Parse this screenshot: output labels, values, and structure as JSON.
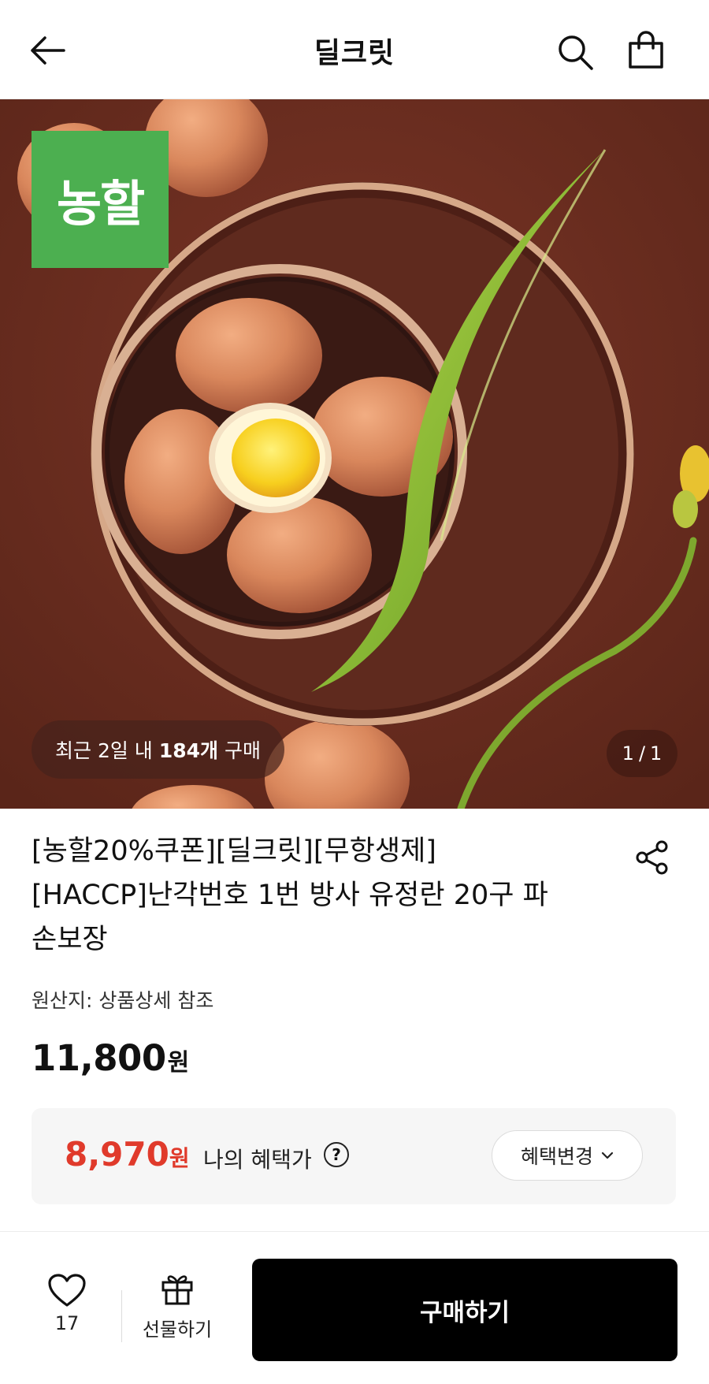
{
  "header": {
    "title": "딜크릿",
    "back_icon": "arrow-left-icon",
    "search_icon": "search-icon",
    "cart_icon": "shopping-bag-icon"
  },
  "hero": {
    "brand_logo_text": "농할",
    "brand_logo_color": "#4caf50",
    "recent_prefix": "최근 2일 내",
    "recent_count": "184개",
    "recent_suffix": "구매",
    "page_current": "1",
    "page_separator": "/",
    "page_total": "1"
  },
  "product": {
    "title_line1": "[농할20%쿠폰][딜크릿][무항생제]",
    "title_line2": "[HACCP]난각번호 1번 방사 유정란 20구 파",
    "title_line3": "손보장",
    "share_icon": "share-icon",
    "origin": "원산지: 상품상세 참조",
    "price_value": "11,800",
    "price_unit": "원"
  },
  "benefit": {
    "price_value": "8,970",
    "price_unit": "원",
    "label": "나의 혜택가",
    "help_symbol": "?",
    "change_label": "혜택변경",
    "accent_color": "#e03a2b"
  },
  "bottom": {
    "like_count": "17",
    "gift_label": "선물하기",
    "buy_label": "구매하기"
  }
}
